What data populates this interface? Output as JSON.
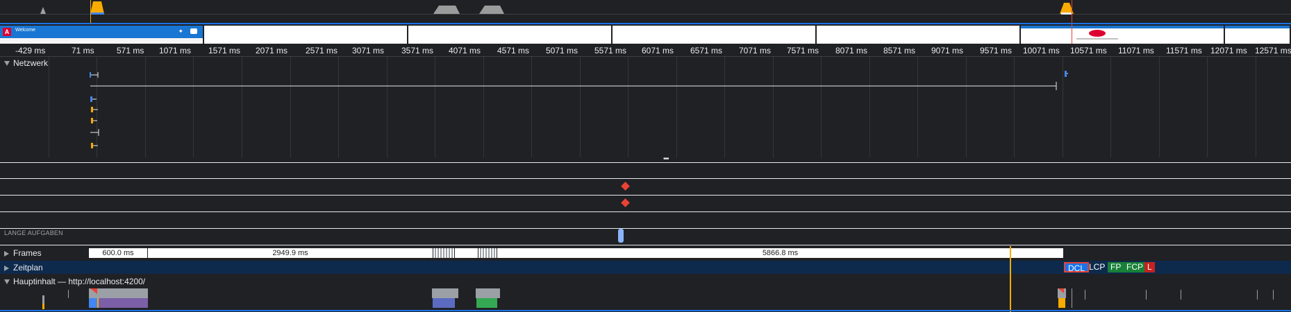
{
  "filmstrip": {
    "app_title": "Welcome",
    "app_logo_letter": "A"
  },
  "ruler": {
    "ticks": [
      "-429 ms",
      "71 ms",
      "571 ms",
      "1071 ms",
      "1571 ms",
      "2071 ms",
      "2571 ms",
      "3071 ms",
      "3571 ms",
      "4071 ms",
      "4571 ms",
      "5071 ms",
      "5571 ms",
      "6071 ms",
      "6571 ms",
      "7071 ms",
      "7571 ms",
      "8071 ms",
      "8571 ms",
      "9071 ms",
      "9571 ms",
      "10071 ms",
      "10571 ms",
      "11071 ms",
      "11571 ms",
      "12071 ms",
      "12571 ms"
    ]
  },
  "tracks": {
    "network": "Netzwerk",
    "long_tasks": "LANGE AUFGABEN",
    "frames": "Frames",
    "timeline": "Zeitplan",
    "main": "Hauptinhalt — http://localhost:4200/"
  },
  "frames": {
    "seg1": "600.0 ms",
    "seg2": "2949.9 ms",
    "seg3": "5866.8 ms"
  },
  "markers": {
    "dcl": "DCL",
    "lcp": "LCP",
    "fp": "FP",
    "fcp": "FCP",
    "l": "L"
  },
  "colors": {
    "background": "#202124",
    "accent": "#1a73e8",
    "timeline_row": "#0d2a4d",
    "fp_fcp": "#188038",
    "load": "#c5221f",
    "long_task_marker": "#ea4335",
    "playhead": "#f9ab00"
  }
}
